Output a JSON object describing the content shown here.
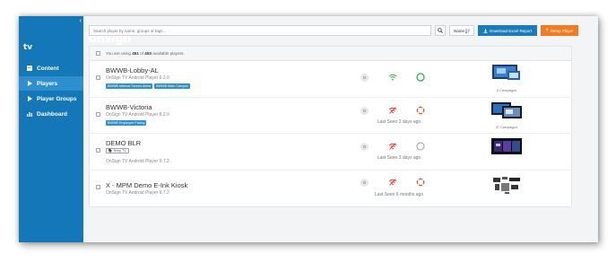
{
  "sidebar": {
    "collapse_glyph": "‹",
    "logo": {
      "main": "onsign",
      "sub": "tv"
    },
    "items": [
      {
        "label": "Content",
        "icon": "content-icon",
        "active": false
      },
      {
        "label": "Players",
        "icon": "play-icon",
        "active": true
      },
      {
        "label": "Player Groups",
        "icon": "play-icon",
        "active": false
      },
      {
        "label": "Dashboard",
        "icon": "chart-icon",
        "active": false
      }
    ]
  },
  "toolbar": {
    "search_placeholder": "Search player by name, groups or tags...",
    "sort_label": "Name",
    "excel_label": "Download Excel Report",
    "setup_label": "Setup Player"
  },
  "summary": {
    "prefix": "You are using",
    "used": "451",
    "of": "of",
    "total": "453",
    "suffix": "available players."
  },
  "players": [
    {
      "name": "BWWB-Lobby-AL",
      "player": "OnSign TV Android Player 9.2.0",
      "tags": [
        "BWWB Internal Screen Alerts",
        "BWWB Main Campus"
      ],
      "count": "0",
      "online": true,
      "last_seen": "",
      "campaigns": "8 Campaigns"
    },
    {
      "name": "BWWB-Victoria",
      "player": "OnSign TV Android Player 8.2.9",
      "tags": [
        "BWWB Employee Facing"
      ],
      "count": "0",
      "online": false,
      "last_seen": "Last Seen 2 days ago",
      "campaigns": "37 Campaigns"
    },
    {
      "name": "DEMO BLR",
      "player": "OnSign TV Android Player 9.7.2",
      "tags": [
        "Temp TV"
      ],
      "count": "0",
      "online": false,
      "last_seen": "Last Seen 3 days ago",
      "campaigns": ""
    },
    {
      "name": "X - MPM Demo E-Ink Kiosk",
      "player": "OnSign TV Android Player 9.7.2",
      "tags": [],
      "count": "0",
      "online": false,
      "last_seen": "Last Seen 6 months ago",
      "campaigns": ""
    }
  ],
  "colors": {
    "sidebar": "#1478b8",
    "primary": "#1a7bbd",
    "accent": "#f47a20",
    "online": "#2aa84a",
    "offline": "#e0453a"
  }
}
